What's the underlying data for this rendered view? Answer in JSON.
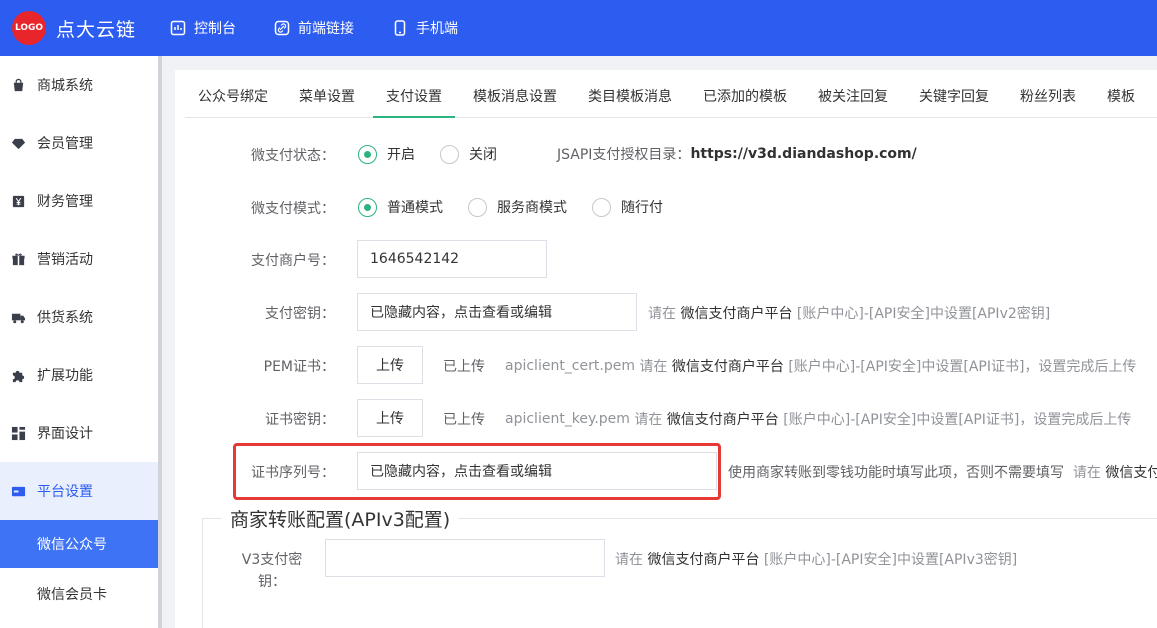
{
  "header": {
    "logo_badge": "LOGO",
    "app_name": "点大云链",
    "nav": [
      {
        "label": "控制台",
        "icon": "dashboard-icon"
      },
      {
        "label": "前端链接",
        "icon": "link-icon"
      },
      {
        "label": "手机端",
        "icon": "phone-icon"
      }
    ]
  },
  "sidebar": {
    "items": [
      {
        "label": "商城系统",
        "icon": "bag-icon"
      },
      {
        "label": "会员管理",
        "icon": "diamond-icon"
      },
      {
        "label": "财务管理",
        "icon": "yen-icon"
      },
      {
        "label": "营销活动",
        "icon": "gift-icon"
      },
      {
        "label": "供货系统",
        "icon": "truck-icon"
      },
      {
        "label": "扩展功能",
        "icon": "puzzle-icon"
      },
      {
        "label": "界面设计",
        "icon": "layout-icon"
      },
      {
        "label": "平台设置",
        "icon": "settings-panel-icon"
      }
    ],
    "sub_items": [
      "微信公众号",
      "微信会员卡"
    ]
  },
  "tabs": [
    "公众号绑定",
    "菜单设置",
    "支付设置",
    "模板消息设置",
    "类目模板消息",
    "已添加的模板",
    "被关注回复",
    "关键字回复",
    "粉丝列表",
    "模板"
  ],
  "form": {
    "pay_status": {
      "label": "微支付状态：",
      "options": [
        "开启",
        "关闭"
      ],
      "jsapi_label": "JSAPI支付授权目录：",
      "jsapi_url": "https://v3d.diandashop.com/"
    },
    "pay_mode": {
      "label": "微支付模式：",
      "options": [
        "普通模式",
        "服务商模式",
        "随行付"
      ]
    },
    "merchant_id": {
      "label": "支付商户号：",
      "value": "1646542142"
    },
    "pay_key": {
      "label": "支付密钥：",
      "placeholder": "已隐藏内容，点击查看或编辑",
      "hint_pre": "请在",
      "hint_platform": "微信支付商户平台",
      "hint_post": "[账户中心]-[API安全]中设置[APIv2密钥]"
    },
    "pem_cert": {
      "label": "PEM证书：",
      "button": "上传",
      "status": "已上传",
      "file": "apiclient_cert.pem",
      "hint_pre": "请在",
      "hint_platform": "微信支付商户平台",
      "hint_post": "[账户中心]-[API安全]中设置[API证书]，设置完成后上传"
    },
    "cert_key": {
      "label": "证书密钥：",
      "button": "上传",
      "status": "已上传",
      "file": "apiclient_key.pem",
      "hint_pre": "请在",
      "hint_platform": "微信支付商户平台",
      "hint_post": "[账户中心]-[API安全]中设置[API证书]，设置完成后上传"
    },
    "cert_serial": {
      "label": "证书序列号：",
      "placeholder": "已隐藏内容，点击查看或编辑",
      "hint": "使用商家转账到零钱功能时填写此项，否则不需要填写",
      "hint_pre": "请在",
      "hint_platform": "微信支付"
    },
    "section_title": "商家转账配置(APIv3配置)",
    "v3_key": {
      "label_line1": "V3支付密",
      "label_line2": "钥：",
      "hint_pre": "请在",
      "hint_platform": "微信支付商户平台",
      "hint_post": "[账户中心]-[API安全]中设置[APIv3密钥]"
    }
  },
  "colors": {
    "primary": "#2d5df0",
    "accent_green": "#2db37d",
    "highlight_red": "#e53935"
  }
}
